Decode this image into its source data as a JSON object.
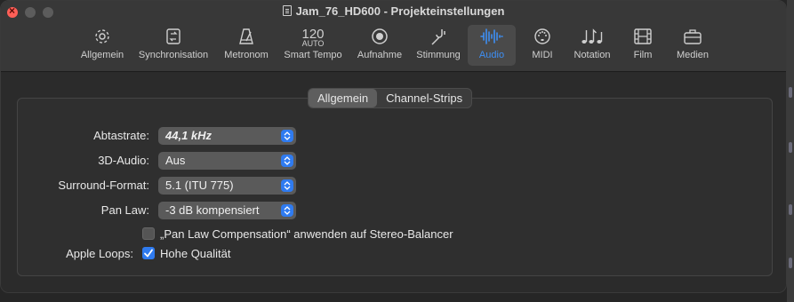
{
  "window": {
    "title": "Jam_76_HD600 - Projekteinstellungen"
  },
  "toolbar": {
    "items": [
      {
        "label": "Allgemein",
        "icon": "gear-icon"
      },
      {
        "label": "Synchronisation",
        "icon": "sync-icon"
      },
      {
        "label": "Metronom",
        "icon": "metronome-icon"
      },
      {
        "label": "Smart Tempo",
        "icon": "tempo-icon",
        "number": "120",
        "sub": "AUTO"
      },
      {
        "label": "Aufnahme",
        "icon": "record-icon"
      },
      {
        "label": "Stimmung",
        "icon": "tuning-fork-icon"
      },
      {
        "label": "Audio",
        "icon": "waveform-icon",
        "active": true
      },
      {
        "label": "MIDI",
        "icon": "midi-icon"
      },
      {
        "label": "Notation",
        "icon": "notes-icon"
      },
      {
        "label": "Film",
        "icon": "film-icon"
      },
      {
        "label": "Medien",
        "icon": "briefcase-icon"
      }
    ]
  },
  "tabs": [
    {
      "label": "Allgemein",
      "selected": true
    },
    {
      "label": "Channel-Strips",
      "selected": false
    }
  ],
  "settings": {
    "sample_rate": {
      "label": "Abtastrate:",
      "value": "44,1 kHz"
    },
    "audio_3d": {
      "label": "3D-Audio:",
      "value": "Aus"
    },
    "surround": {
      "label": "Surround-Format:",
      "value": "5.1 (ITU 775)"
    },
    "pan_law": {
      "label": "Pan Law:",
      "value": "-3 dB kompensiert"
    },
    "pan_law_comp": {
      "label": "„Pan Law Compensation“ anwenden auf Stereo-Balancer",
      "checked": false
    },
    "apple_loops": {
      "label": "Apple Loops:",
      "option": "Hohe Qualität",
      "checked": true
    }
  },
  "colors": {
    "accent": "#2f7bf0",
    "close": "#ff5f57",
    "active_label": "#3d8ff5"
  }
}
